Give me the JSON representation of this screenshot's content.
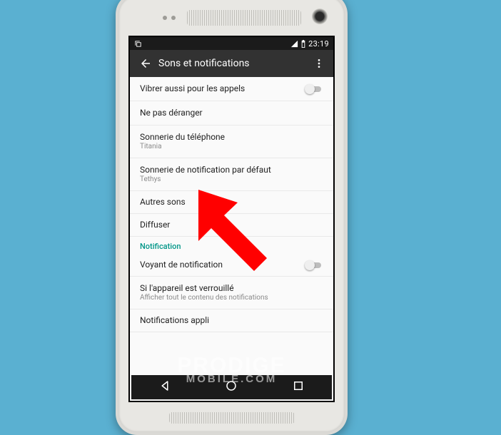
{
  "statusbar": {
    "time": "23:19"
  },
  "appbar": {
    "title": "Sons et notifications"
  },
  "rows": {
    "vibrate": {
      "label": "Vibrer aussi pour les appels"
    },
    "dnd": {
      "label": "Ne pas déranger"
    },
    "ringtone": {
      "label": "Sonnerie du téléphone",
      "value": "Titania"
    },
    "notif_sound": {
      "label": "Sonnerie de notification par défaut",
      "value": "Tethys"
    },
    "other_sounds": {
      "label": "Autres sons"
    },
    "cast": {
      "label": "Diffuser"
    },
    "section_notification": "Notification",
    "notif_light": {
      "label": "Voyant de notification"
    },
    "locked": {
      "label": "Si l'appareil est verrouillé",
      "value": "Afficher tout le contenu des notifications"
    },
    "app_notif": {
      "label": "Notifications appli"
    }
  },
  "watermark": {
    "line1": "PRODIGE",
    "line2": "MOBILE.COM"
  }
}
